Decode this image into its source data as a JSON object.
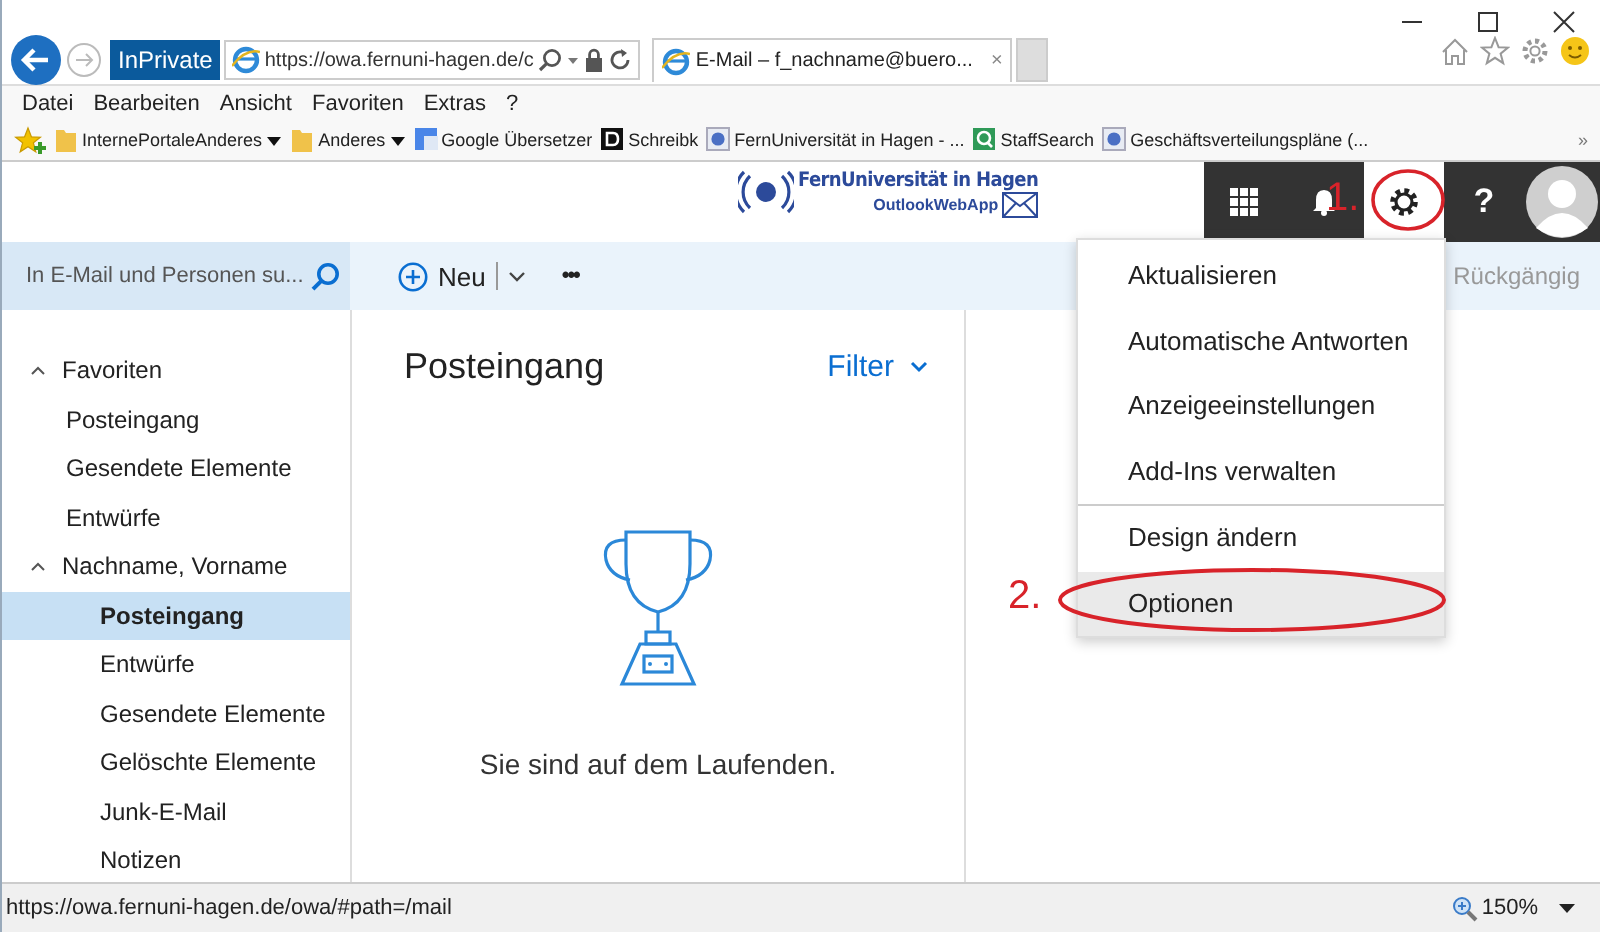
{
  "browser": {
    "address": "https://owa.fernuni-hagen.de/c",
    "inprivate": "InPrivate",
    "tab_title": "E-Mail – f_nachname@buero...",
    "tab_close": "×",
    "menu": [
      "Datei",
      "Bearbeiten",
      "Ansicht",
      "Favoriten",
      "Extras",
      "?"
    ],
    "favorites": [
      {
        "label": "InternePortaleAnderes",
        "kind": "folder",
        "dropdown": true
      },
      {
        "label": "Anderes",
        "kind": "folder",
        "dropdown": true
      },
      {
        "label": "Google Übersetzer",
        "kind": "translate",
        "dropdown": false
      },
      {
        "label": "Schreibk",
        "kind": "d",
        "dropdown": false
      },
      {
        "label": "FernUniversität in Hagen - ...",
        "kind": "site",
        "dropdown": false
      },
      {
        "label": "StaffSearch",
        "kind": "search",
        "dropdown": false
      },
      {
        "label": "Geschäftsverteilungspläne (...",
        "kind": "site",
        "dropdown": false
      }
    ],
    "more": "»"
  },
  "header": {
    "logo_name": "FernUniversität in Hagen",
    "logo_sub": "OutlookWebApp",
    "help": "?"
  },
  "search": {
    "placeholder": "In E-Mail und Personen su..."
  },
  "toolbar": {
    "new": "Neu",
    "more": "•••",
    "undo": "Rückgängig"
  },
  "folders": [
    {
      "label": "Favoriten",
      "kind": "favorites",
      "expanded": true,
      "children": [
        {
          "label": "Posteingang",
          "selected": false
        },
        {
          "label": "Gesendete Elemente",
          "selected": false
        },
        {
          "label": "Entwürfe",
          "selected": false
        }
      ]
    },
    {
      "label": "Nachname, Vorname",
      "kind": "mailbox",
      "expanded": true,
      "children": [
        {
          "label": "Posteingang",
          "selected": true
        },
        {
          "label": "Entwürfe",
          "selected": false
        },
        {
          "label": "Gesendete Elemente",
          "selected": false
        },
        {
          "label": "Gelöschte Elemente",
          "selected": false
        },
        {
          "label": "Junk-E-Mail",
          "selected": false
        },
        {
          "label": "Notizen",
          "selected": false
        }
      ]
    }
  ],
  "list": {
    "title": "Posteingang",
    "filter": "Filter",
    "empty": "Sie sind auf dem Laufenden."
  },
  "settings_menu": [
    {
      "label": "Aktualisieren",
      "selected": false,
      "divider_before": false
    },
    {
      "label": "Automatische Antworten",
      "selected": false,
      "divider_before": false
    },
    {
      "label": "Anzeigeeinstellungen",
      "selected": false,
      "divider_before": false
    },
    {
      "label": "Add-Ins verwalten",
      "selected": false,
      "divider_before": false
    },
    {
      "label": "Design ändern",
      "selected": false,
      "divider_before": true
    },
    {
      "label": "Optionen",
      "selected": true,
      "divider_before": false
    }
  ],
  "annotations": [
    "1.",
    "2."
  ],
  "status_bar": {
    "url": "https://owa.fernuni-hagen.de/owa/#path=/mail",
    "zoom": "150%"
  }
}
